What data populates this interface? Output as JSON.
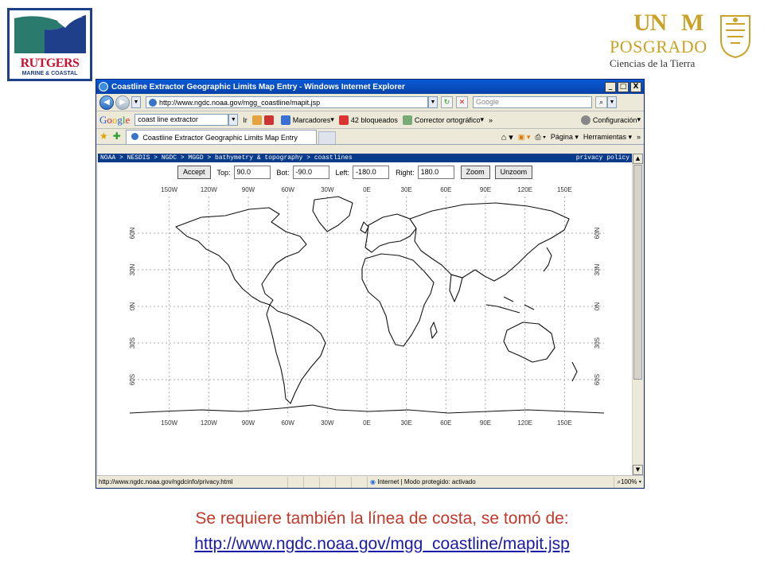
{
  "slide": {
    "logo_left_name": "RUTGERS",
    "logo_left_sub": "MARINE & COASTAL",
    "logo_right_un": "UN",
    "logo_right_m": "M",
    "logo_right_posgrado": "POSGRADO",
    "logo_right_ciencias": "Ciencias de la Tierra",
    "caption": "Se requiere también la línea de costa, se tomó de:",
    "caption_link": "http://www.ngdc.noaa.gov/mgg_coastline/mapit.jsp"
  },
  "window": {
    "title": "Coastline Extractor Geographic Limits Map Entry - Windows Internet Explorer",
    "controls": [
      "_",
      "□",
      "X"
    ]
  },
  "toolbar": {
    "address": "http://www.ngdc.noaa.gov/mgg_coastline/mapit.jsp",
    "search_placeholder": "Google"
  },
  "googlebar": {
    "brand": "Google",
    "query": "coast line extractor",
    "go": "Ir",
    "bookmarks": "Marcadores",
    "blocked": "42 bloqueados",
    "spell": "Corrector ortográfico",
    "more": "»",
    "settings": "Configuración"
  },
  "tabs": {
    "active": "Coastline Extractor Geographic Limits Map Entry",
    "page": "Página",
    "tools": "Herramientas",
    "more": "»"
  },
  "page": {
    "breadcrumb": "NOAA > NESDIS > NGDC > MGGD > bathymetry & topography > coastlines",
    "privacy": "privacy policy",
    "accept": "Accept",
    "top_label": "Top:",
    "top_value": "90.0",
    "bot_label": "Bot:",
    "bot_value": "-90.0",
    "left_label": "Left:",
    "left_value": "-180.0",
    "right_label": "Right:",
    "right_value": "180.0",
    "zoom": "Zoom",
    "unzoom": "Unzoom"
  },
  "map": {
    "lon_labels": [
      "150W",
      "120W",
      "90W",
      "60W",
      "30W",
      "0E",
      "30E",
      "60E",
      "90E",
      "120E",
      "150E"
    ],
    "lat_labels": [
      "60N",
      "30N",
      "0N",
      "30S",
      "60S"
    ],
    "grid": true
  },
  "status": {
    "url": "http://www.ngdc.noaa.gov/ngdcinfo/privacy.html",
    "zone": "Internet | Modo protegido: activado",
    "zoom": "100%"
  },
  "colors": {
    "caption": "#c0392b",
    "link": "#1a1aa8",
    "titlebar": "#0a5ad8",
    "breadcrumb_bg": "#0a3b8a"
  }
}
